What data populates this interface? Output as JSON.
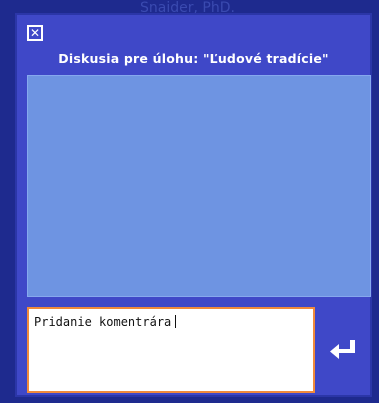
{
  "background": {
    "name_text": "Snaider, PhD."
  },
  "dialog": {
    "title": "Diskusia pre úlohu: \"Ľudové tradície\"",
    "close_glyph": "✕",
    "comment_placeholder": "Pridanie komentrára"
  },
  "colors": {
    "panel": "#3f48c8",
    "discussion_area": "#6e94e2",
    "input_border": "#f08a3c",
    "page_bg": "#1e2a8e"
  },
  "icons": {
    "close": "close-icon",
    "send": "enter-return-icon"
  }
}
